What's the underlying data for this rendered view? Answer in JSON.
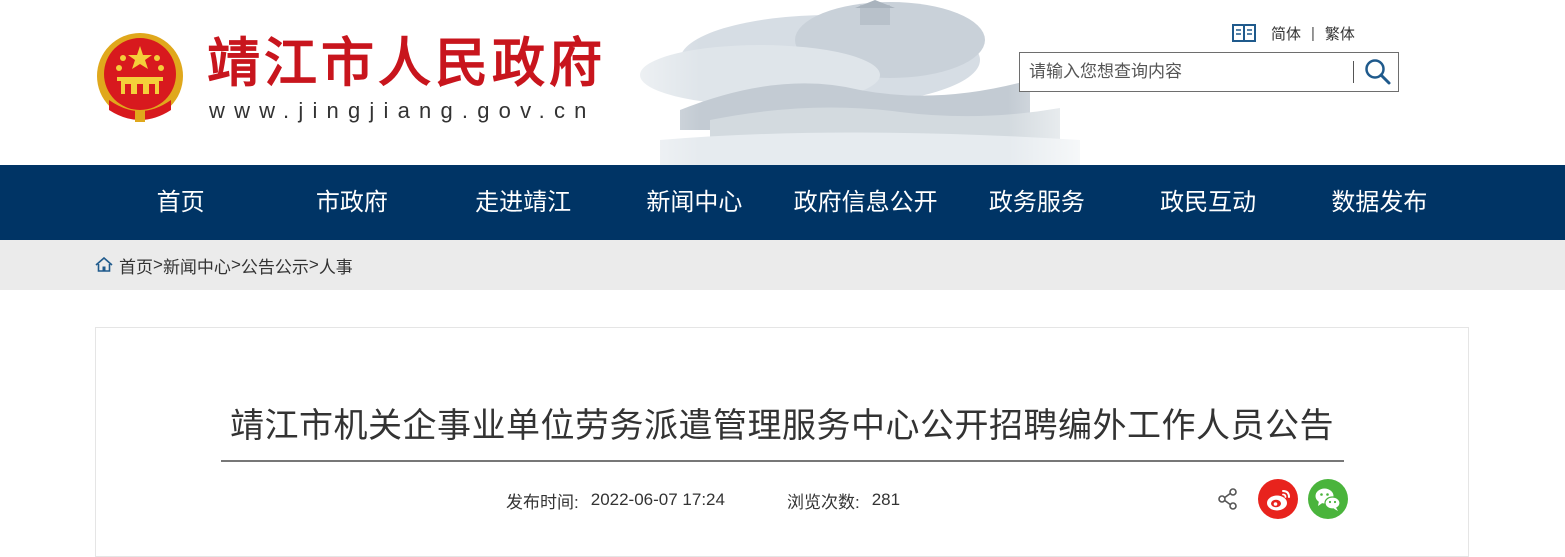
{
  "header": {
    "site_title": "靖江市人民政府",
    "site_url": "www.jingjiang.gov.cn",
    "lang": {
      "simplified": "简体",
      "separator": "|",
      "traditional": "繁体"
    },
    "search": {
      "placeholder": "请输入您想查询内容",
      "value": ""
    }
  },
  "nav": {
    "items": [
      "首页",
      "市政府",
      "走进靖江",
      "新闻中心",
      "政府信息公开",
      "政务服务",
      "政民互动",
      "数据发布"
    ]
  },
  "breadcrumb": {
    "items": [
      "首页",
      "新闻中心",
      "公告公示",
      "人事"
    ],
    "separator": ">"
  },
  "article": {
    "title": "靖江市机关企事业单位劳务派遣管理服务中心公开招聘编外工作人员公告",
    "published_label": "发布时间:",
    "published_value": "2022-06-07 17:24",
    "views_label": "浏览次数:",
    "views_value": "281"
  },
  "icons": {
    "book": "book-icon",
    "search": "search-icon",
    "home": "home-icon",
    "share": "share-icon",
    "weibo": "weibo-icon",
    "wechat": "wechat-icon"
  },
  "colors": {
    "brand_red": "#c8151d",
    "nav_blue": "#003465",
    "breadcrumb_bg": "#ebebeb",
    "weibo_red": "#e8231d",
    "wechat_green": "#4ab43c"
  }
}
